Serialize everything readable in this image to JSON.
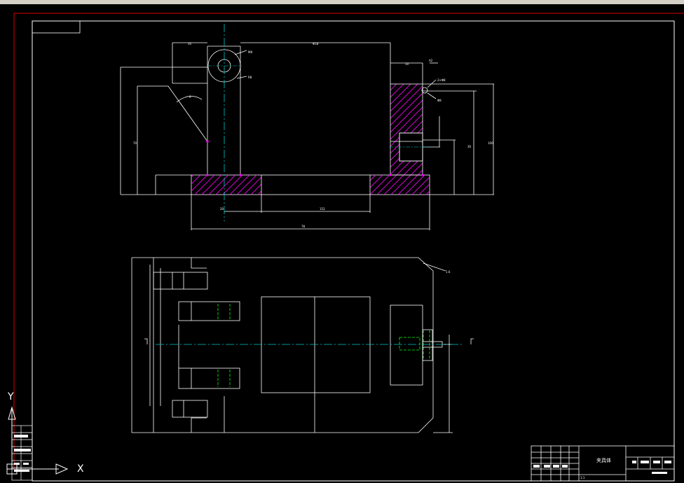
{
  "drawing": {
    "title_block_name": "夹具体",
    "title_block_scale": "1:1",
    "small_labels": [
      "M8",
      "R8",
      "35",
      "10",
      "Φ18",
      "2×Φ8",
      "Φ8",
      "6",
      "152",
      "78",
      "20",
      "70",
      "100",
      "30",
      "A2",
      "1.6"
    ]
  },
  "ucs": {
    "x_axis_label": "X",
    "y_axis_label": "Y"
  },
  "colors": {
    "border": "#e00000",
    "lines": "#ffffff",
    "center_lines": "#00c8c8",
    "hatch": "#ff00ff",
    "hidden": "#00ff00",
    "ucs": "#ffffff"
  }
}
